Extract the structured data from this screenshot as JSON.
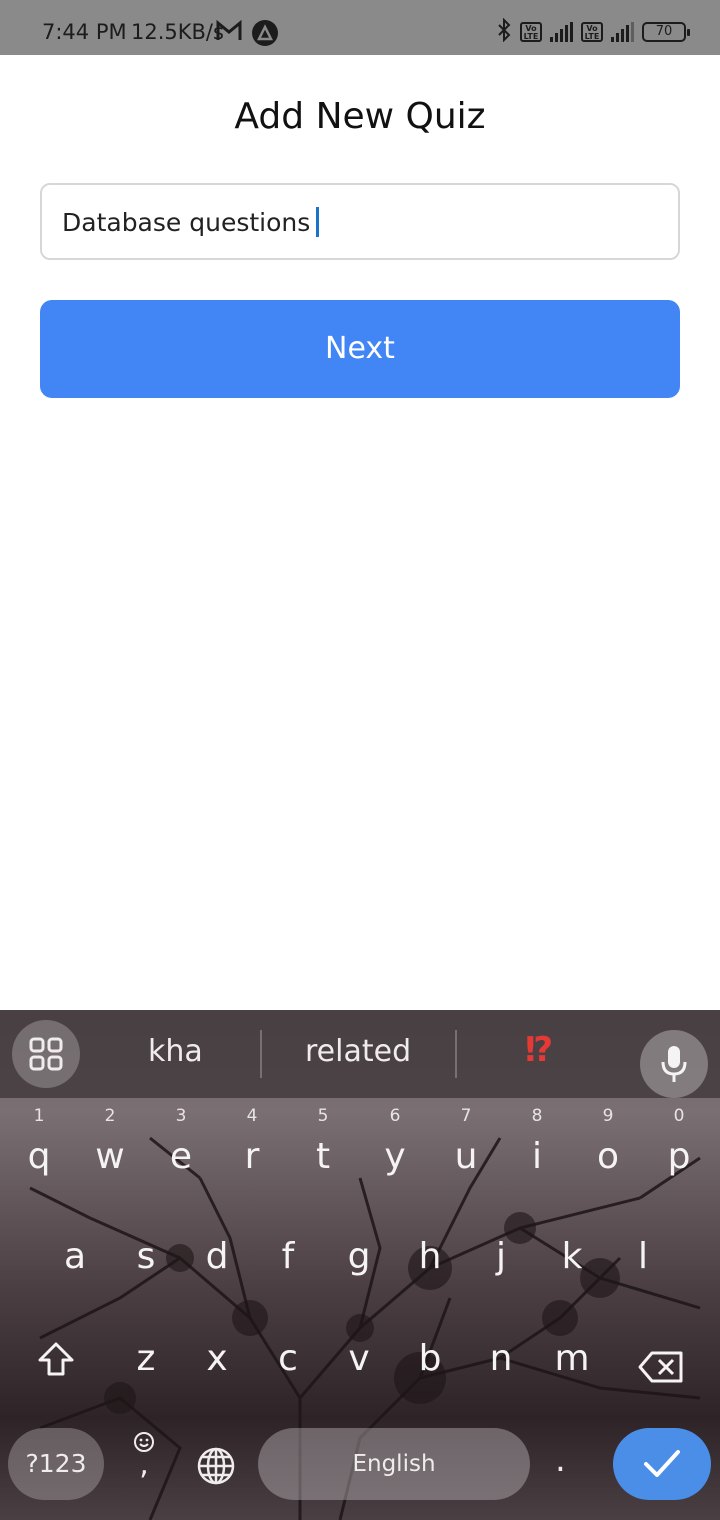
{
  "status_bar": {
    "time": "7:44 PM",
    "speed": "12.5KB/s",
    "battery": "70"
  },
  "page": {
    "title": "Add New Quiz",
    "input_value": "Database questions",
    "next_label": "Next"
  },
  "keyboard": {
    "suggestions": [
      "kha",
      "related",
      "⁉"
    ],
    "row1": [
      {
        "label": "q",
        "hint": "1"
      },
      {
        "label": "w",
        "hint": "2"
      },
      {
        "label": "e",
        "hint": "3"
      },
      {
        "label": "r",
        "hint": "4"
      },
      {
        "label": "t",
        "hint": "5"
      },
      {
        "label": "y",
        "hint": "6"
      },
      {
        "label": "u",
        "hint": "7"
      },
      {
        "label": "i",
        "hint": "8"
      },
      {
        "label": "o",
        "hint": "9"
      },
      {
        "label": "p",
        "hint": "0"
      }
    ],
    "row2": [
      "a",
      "s",
      "d",
      "f",
      "g",
      "h",
      "j",
      "k",
      "l"
    ],
    "row3": [
      "z",
      "x",
      "c",
      "v",
      "b",
      "n",
      "m"
    ],
    "symbols_label": "?123",
    "emoji_label": ",",
    "space_label": "English",
    "period_label": "."
  },
  "colors": {
    "accent": "#4285f4",
    "enter": "#4a8ee8",
    "status_bar": "#8a8a8a"
  }
}
